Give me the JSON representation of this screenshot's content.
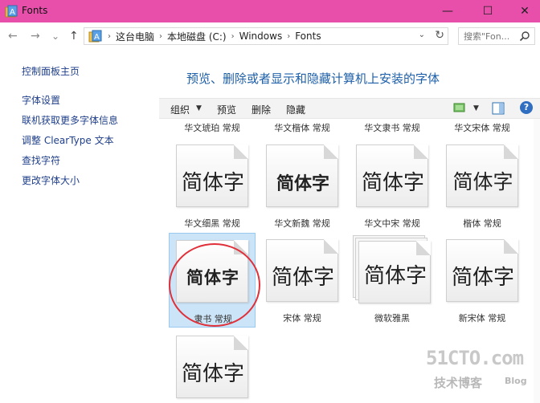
{
  "window": {
    "title": "Fonts",
    "minimize": "—",
    "maximize": "☐",
    "close": "✕",
    "titlebar_color": "#e84fab"
  },
  "nav": {
    "back": "←",
    "forward": "→",
    "recent": "⌄",
    "up": "↑",
    "breadcrumb": [
      "这台电脑",
      "本地磁盘 (C:)",
      "Windows",
      "Fonts"
    ],
    "separator": "›",
    "dropdown": "⌄",
    "refresh": "↻",
    "search_placeholder": "搜索\"Fon..."
  },
  "sidebar": {
    "home": "控制面板主页",
    "links": [
      "字体设置",
      "联机获取更多字体信息",
      "调整 ClearType 文本",
      "查找字符",
      "更改字体大小"
    ]
  },
  "main": {
    "heading": "预览、删除或者显示和隐藏计算机上安装的字体"
  },
  "toolbar": {
    "organize": "组织",
    "caret": "▼",
    "preview": "预览",
    "delete": "删除",
    "hide": "隐藏",
    "help": "?"
  },
  "fonts": {
    "sample": "简体字",
    "top_labels": [
      "华文琥珀 常规",
      "华文楷体 常规",
      "华文隶书 常规",
      "华文宋体 常规"
    ],
    "row1": [
      "华文细黑 常规",
      "华文新魏 常规",
      "华文中宋 常规",
      "楷体 常规"
    ],
    "row2": [
      "隶书 常规",
      "宋体 常规",
      "微软雅黑",
      "新宋体 常规"
    ]
  },
  "watermark": {
    "line1": "51CTO.com",
    "line2": "技术博客",
    "line3": "Blog"
  },
  "colors": {
    "link": "#1f3f8a",
    "heading": "#1d5fa8",
    "selection": "#cce4f7",
    "annotation": "#e0303a"
  }
}
